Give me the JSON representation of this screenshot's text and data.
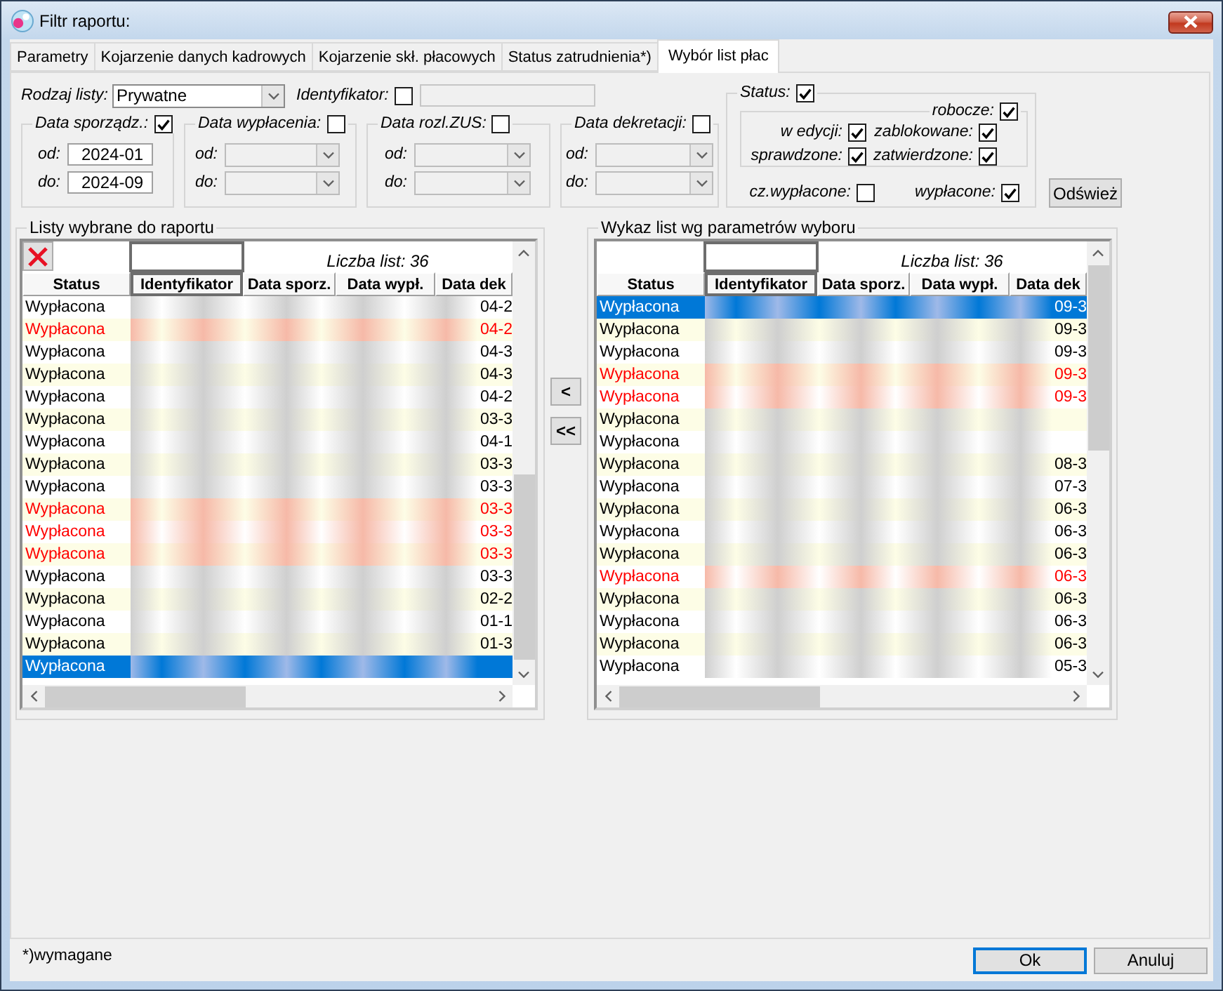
{
  "window": {
    "title": "Filtr raportu:"
  },
  "tabs": [
    {
      "label": "Parametry",
      "selected": false
    },
    {
      "label": "Kojarzenie danych kadrowych",
      "selected": false
    },
    {
      "label": "Kojarzenie skł. płacowych",
      "selected": false
    },
    {
      "label": "Status zatrudnienia*)",
      "selected": false
    },
    {
      "label": "Wybór list płac",
      "selected": true
    }
  ],
  "filters": {
    "list_type": {
      "label": "Rodzaj listy:",
      "value": "Prywatne"
    },
    "identifier": {
      "label": "Identyfikator:",
      "checked": false
    },
    "date_ranges": [
      {
        "label": "Data sporządz.:",
        "checked": true,
        "from": {
          "label": "od:",
          "value": "2024-01"
        },
        "to": {
          "label": "do:",
          "value": "2024-09"
        }
      },
      {
        "label": "Data wypłacenia:",
        "checked": false,
        "from": {
          "label": "od:"
        },
        "to": {
          "label": "do:"
        }
      },
      {
        "label": "Data rozl.ZUS:",
        "checked": false,
        "from": {
          "label": "od:"
        },
        "to": {
          "label": "do:"
        }
      },
      {
        "label": "Data dekretacji:",
        "checked": false,
        "from": {
          "label": "od:"
        },
        "to": {
          "label": "do:"
        }
      }
    ],
    "status": {
      "label": "Status:",
      "checked": true,
      "draft": {
        "label": "robocze:",
        "checked": true
      },
      "options": [
        {
          "label": "w edycji:",
          "checked": true
        },
        {
          "label": "zablokowane:",
          "checked": true
        },
        {
          "label": "sprawdzone:",
          "checked": true
        },
        {
          "label": "zatwierdzone:",
          "checked": true
        }
      ],
      "payment": [
        {
          "label": "cz.wypłacone:",
          "checked": false
        },
        {
          "label": "wypłacone:",
          "checked": true
        }
      ]
    },
    "refresh_button": "Odśwież"
  },
  "selected_lists": {
    "title": "Listy wybrane do raportu",
    "remove_button": true,
    "count": "Liczba list: 36",
    "columns": [
      {
        "label": "Status",
        "selected": false
      },
      {
        "label": "Identyfikator",
        "selected": true
      },
      {
        "label": "Data sporz.",
        "selected": false
      },
      {
        "label": "Data wypł.",
        "selected": false
      },
      {
        "label": "Data dek",
        "selected": false
      }
    ],
    "rows": [
      {
        "status": "Wypłacona",
        "color": "#000000",
        "selected": false,
        "data_dek": "04-2"
      },
      {
        "status": "Wypłacona",
        "color": "#ff0000",
        "selected": false,
        "data_dek": "04-2"
      },
      {
        "status": "Wypłacona",
        "color": "#000000",
        "selected": false,
        "data_dek": "04-3"
      },
      {
        "status": "Wypłacona",
        "color": "#000000",
        "selected": false,
        "data_dek": "04-3"
      },
      {
        "status": "Wypłacona",
        "color": "#000000",
        "selected": false,
        "data_dek": "04-2"
      },
      {
        "status": "Wypłacona",
        "color": "#000000",
        "selected": false,
        "data_dek": "03-3"
      },
      {
        "status": "Wypłacona",
        "color": "#000000",
        "selected": false,
        "data_dek": "04-1"
      },
      {
        "status": "Wypłacona",
        "color": "#000000",
        "selected": false,
        "data_dek": "03-3"
      },
      {
        "status": "Wypłacona",
        "color": "#000000",
        "selected": false,
        "data_dek": "03-3"
      },
      {
        "status": "Wypłacona",
        "color": "#ff0000",
        "selected": false,
        "data_dek": "03-3"
      },
      {
        "status": "Wypłacona",
        "color": "#ff0000",
        "selected": false,
        "data_dek": "03-3"
      },
      {
        "status": "Wypłacona",
        "color": "#ff0000",
        "selected": false,
        "data_dek": "03-3"
      },
      {
        "status": "Wypłacona",
        "color": "#000000",
        "selected": false,
        "data_dek": "03-3"
      },
      {
        "status": "Wypłacona",
        "color": "#000000",
        "selected": false,
        "data_dek": "02-2"
      },
      {
        "status": "Wypłacona",
        "color": "#000000",
        "selected": false,
        "data_dek": "01-1"
      },
      {
        "status": "Wypłacona",
        "color": "#000000",
        "selected": false,
        "data_dek": "01-3"
      },
      {
        "status": "Wypłacona",
        "selected": true
      }
    ]
  },
  "move_buttons": [
    "<",
    "<<"
  ],
  "available_lists": {
    "title": "Wykaz list wg parametrów wyboru",
    "remove_button": false,
    "count": "Liczba list: 36",
    "columns": [
      {
        "label": "Status",
        "selected": false
      },
      {
        "label": "Identyfikator",
        "selected": true
      },
      {
        "label": "Data sporz.",
        "selected": false
      },
      {
        "label": "Data wypł.",
        "selected": false
      },
      {
        "label": "Data dek",
        "selected": false
      }
    ],
    "rows": [
      {
        "status": "Wypłacona",
        "selected": true,
        "data_dek": "09-3"
      },
      {
        "status": "Wypłacona",
        "color": "#000000",
        "selected": false,
        "data_dek": "09-3"
      },
      {
        "status": "Wypłacona",
        "color": "#000000",
        "selected": false,
        "data_dek": "09-3"
      },
      {
        "status": "Wypłacona",
        "color": "#ff0000",
        "selected": false,
        "data_dek": "09-3"
      },
      {
        "status": "Wypłacona",
        "color": "#ff0000",
        "selected": false,
        "data_dek": "09-3"
      },
      {
        "status": "Wypłacona",
        "color": "#000000",
        "selected": false
      },
      {
        "status": "Wypłacona",
        "color": "#000000",
        "selected": false
      },
      {
        "status": "Wypłacona",
        "color": "#000000",
        "selected": false,
        "data_dek": "08-3"
      },
      {
        "status": "Wypłacona",
        "color": "#000000",
        "selected": false,
        "data_dek": "07-3"
      },
      {
        "status": "Wypłacona",
        "color": "#000000",
        "selected": false,
        "data_dek": "06-3"
      },
      {
        "status": "Wypłacona",
        "color": "#000000",
        "selected": false,
        "data_dek": "06-3"
      },
      {
        "status": "Wypłacona",
        "color": "#000000",
        "selected": false,
        "data_dek": "06-3"
      },
      {
        "status": "Wypłacona",
        "color": "#ff0000",
        "selected": false,
        "data_dek": "06-3"
      },
      {
        "status": "Wypłacona",
        "color": "#000000",
        "selected": false,
        "data_dek": "06-3"
      },
      {
        "status": "Wypłacona",
        "color": "#000000",
        "selected": false,
        "data_dek": "06-3"
      },
      {
        "status": "Wypłacona",
        "color": "#000000",
        "selected": false,
        "data_dek": "06-3"
      },
      {
        "status": "Wypłacona",
        "color": "#000000",
        "selected": false,
        "data_dek": "05-3"
      }
    ]
  },
  "footnote": "*)wymagane",
  "buttons": [
    {
      "label": "Ok",
      "focused": true
    },
    {
      "label": "Anuluj",
      "focused": false
    }
  ]
}
